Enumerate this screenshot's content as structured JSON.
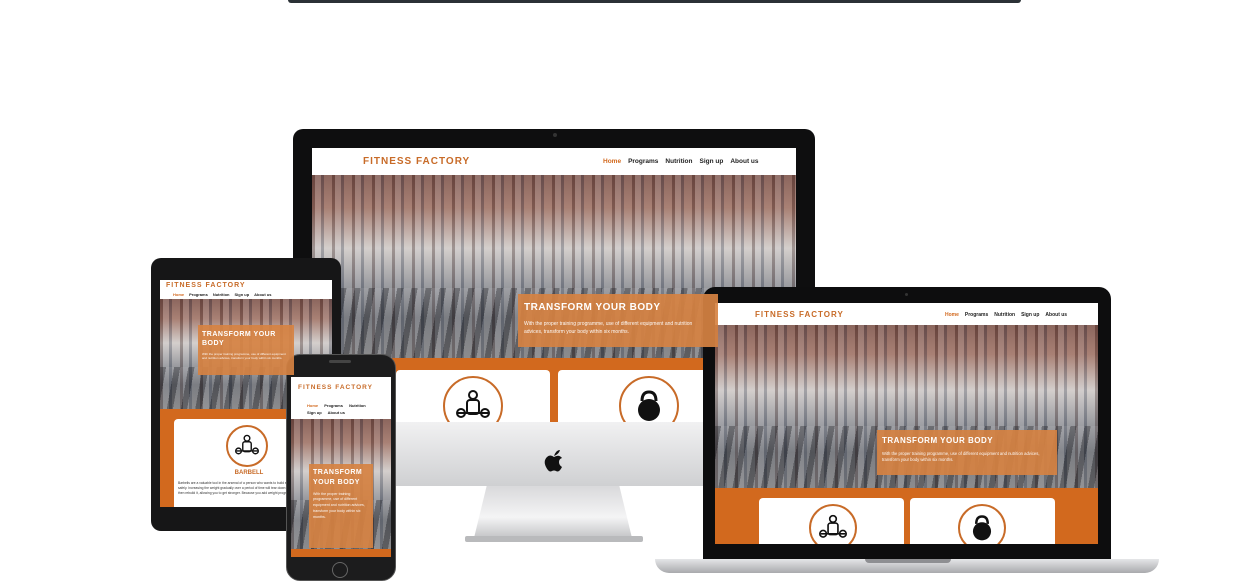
{
  "site": {
    "brand": "FITNESS FACTORY",
    "nav": [
      "Home",
      "Programs",
      "Nutrition",
      "Sign up",
      "About us"
    ],
    "nav_tablet": [
      "Home",
      "Programs",
      "Nutrition",
      "Sign up",
      "About us"
    ],
    "hero_title": "TRANSFORM YOUR BODY",
    "hero_text": "With the proper training programme, use of different equipment and nutrition advices, transform your body within six months.",
    "card_title": "BARBELL",
    "card_text": "Barbells are a valuable tool in the arsenal of a person who wants to build strength efficiently and safely. Increasing the weight gradually over a period of time will tear down muscle tissue and then rebuild it, allowing you to get stronger. Because you add weight progressively with barbells..."
  },
  "icons": {
    "apple": "apple-logo-icon",
    "weightlifter": "weightlifter-icon",
    "kettlebell": "kettlebell-icon"
  },
  "colors": {
    "accent": "#d2691e",
    "brand": "#c86b28",
    "hero_box": "#d68242"
  }
}
